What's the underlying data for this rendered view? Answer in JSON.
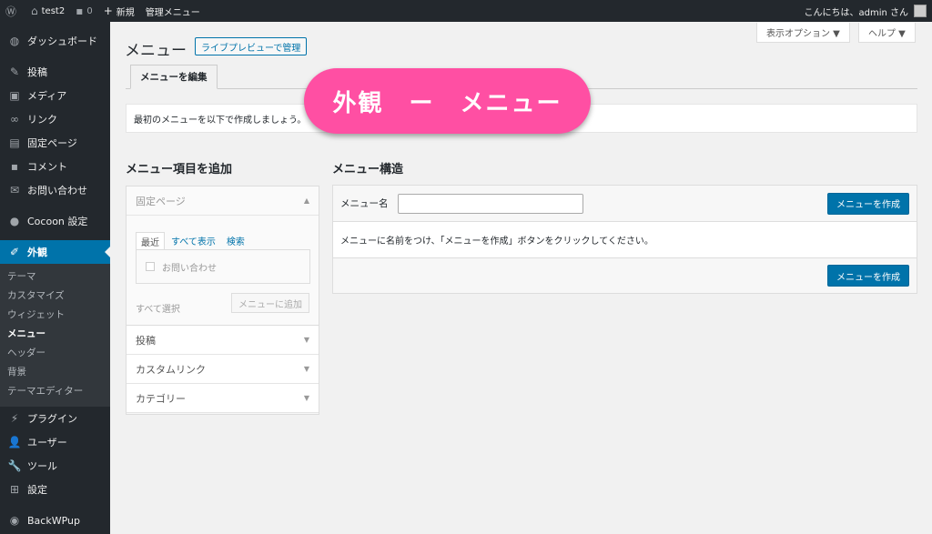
{
  "adminbar": {
    "site_name": "test2",
    "comments_count": "0",
    "new_label": "新規",
    "admin_menu_label": "管理メニュー",
    "greeting": "こんにちは、admin さん"
  },
  "sidebar": {
    "items": [
      {
        "label": "ダッシュボード",
        "icon": "dashboard-icon"
      },
      {
        "label": "投稿",
        "icon": "pin-icon"
      },
      {
        "label": "メディア",
        "icon": "media-icon"
      },
      {
        "label": "リンク",
        "icon": "link-icon"
      },
      {
        "label": "固定ページ",
        "icon": "page-icon"
      },
      {
        "label": "コメント",
        "icon": "comment-icon"
      },
      {
        "label": "お問い合わせ",
        "icon": "mail-icon"
      },
      {
        "label": "Cocoon 設定",
        "icon": "circle-icon"
      },
      {
        "label": "外観",
        "icon": "brush-icon"
      },
      {
        "label": "プラグイン",
        "icon": "plugin-icon"
      },
      {
        "label": "ユーザー",
        "icon": "user-icon"
      },
      {
        "label": "ツール",
        "icon": "wrench-icon"
      },
      {
        "label": "設定",
        "icon": "settings-icon"
      },
      {
        "label": "BackWPup",
        "icon": "backwpup-icon"
      }
    ],
    "submenu": [
      "テーマ",
      "カスタマイズ",
      "ウィジェット",
      "メニュー",
      "ヘッダー",
      "背景",
      "テーマエディター"
    ]
  },
  "header": {
    "screen_options": "表示オプション ▼",
    "help": "ヘルプ ▼",
    "title": "メニュー",
    "live_preview": "ライブプレビューで管理",
    "tab_edit": "メニューを編集",
    "notice": "最初のメニューを以下で作成しましょう。",
    "banner": "外観　ー　メニュー"
  },
  "add_items": {
    "heading": "メニュー項目を追加",
    "sections": [
      {
        "label": "固定ページ",
        "arrow": "▲"
      },
      {
        "label": "投稿",
        "arrow": "▼"
      },
      {
        "label": "カスタムリンク",
        "arrow": "▼"
      },
      {
        "label": "カテゴリー",
        "arrow": "▼"
      }
    ],
    "tabs": [
      "最近",
      "すべて表示",
      "検索"
    ],
    "page_item": "お問い合わせ",
    "select_all": "すべて選択",
    "add_button": "メニューに追加"
  },
  "structure": {
    "heading": "メニュー構造",
    "name_label": "メニュー名",
    "name_value": "",
    "create_button": "メニューを作成",
    "instructions": "メニューに名前をつけ、「メニューを作成」ボタンをクリックしてください。",
    "create_button_bottom": "メニューを作成"
  },
  "colors": {
    "admin_bar": "#23282d",
    "accent": "#0073aa",
    "banner": "#ff4fa3"
  }
}
